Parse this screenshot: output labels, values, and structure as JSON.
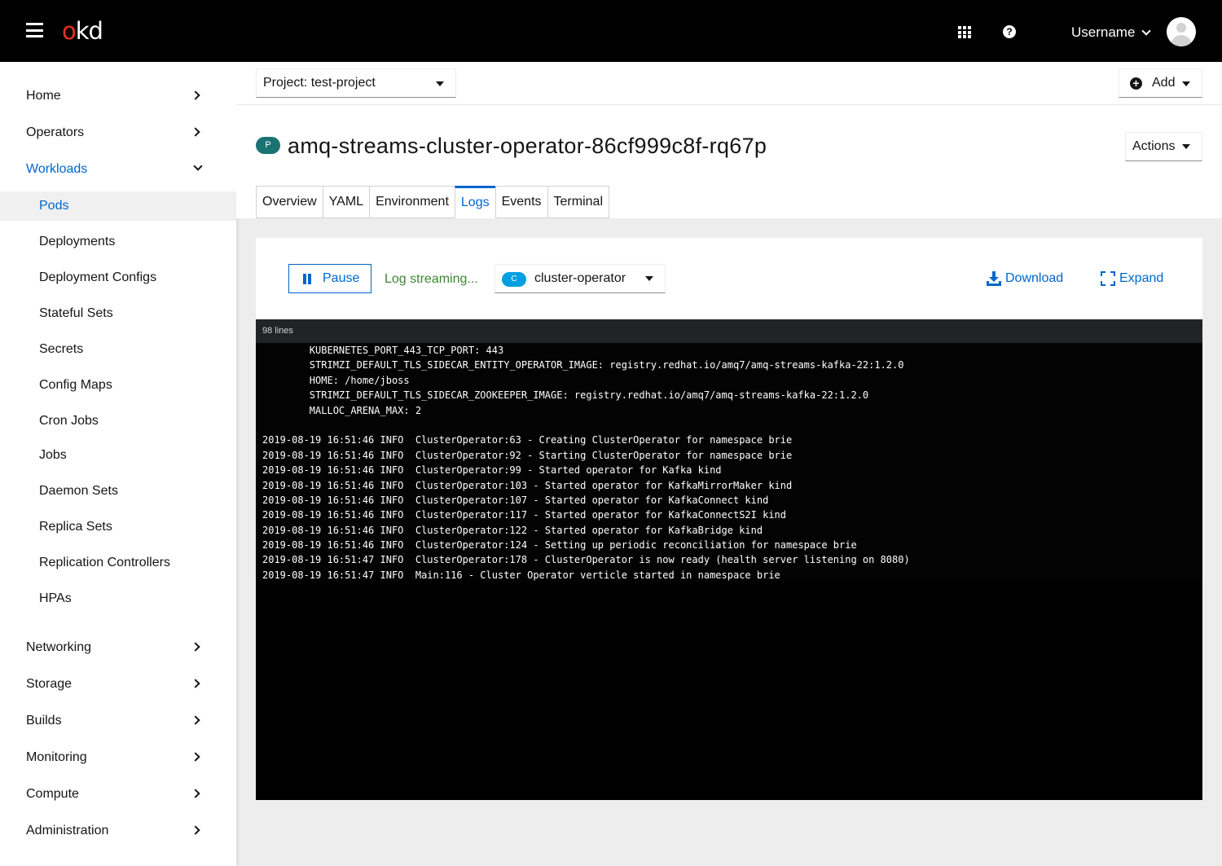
{
  "masthead": {
    "logo_o": "o",
    "logo_kd": "kd",
    "username": "Username"
  },
  "sidebar": {
    "sections_top": [
      {
        "label": "Home"
      },
      {
        "label": "Operators"
      }
    ],
    "workloads": {
      "label": "Workloads",
      "items": [
        {
          "label": "Pods",
          "active": true
        },
        {
          "label": "Deployments"
        },
        {
          "label": "Deployment Configs"
        },
        {
          "label": "Stateful Sets"
        },
        {
          "label": "Secrets"
        },
        {
          "label": "Config Maps"
        },
        {
          "label": "Cron Jobs"
        },
        {
          "label": "Jobs"
        },
        {
          "label": "Daemon Sets"
        },
        {
          "label": "Replica Sets"
        },
        {
          "label": "Replication Controllers"
        },
        {
          "label": "HPAs"
        }
      ]
    },
    "sections_bottom": [
      {
        "label": "Networking"
      },
      {
        "label": "Storage"
      },
      {
        "label": "Builds"
      },
      {
        "label": "Monitoring"
      },
      {
        "label": "Compute"
      },
      {
        "label": "Administration"
      }
    ]
  },
  "project": {
    "label": "Project: test-project"
  },
  "add_button": {
    "label": "Add"
  },
  "pod": {
    "badge": "P",
    "name": "amq-streams-cluster-operator-86cf999c8f-rq67p"
  },
  "actions_button": {
    "label": "Actions"
  },
  "tabs": [
    {
      "label": "Overview"
    },
    {
      "label": "YAML"
    },
    {
      "label": "Environment"
    },
    {
      "label": "Logs",
      "active": true
    },
    {
      "label": "Events"
    },
    {
      "label": "Terminal"
    }
  ],
  "logs": {
    "pause_label": "Pause",
    "status": "Log streaming...",
    "container_badge": "C",
    "container": "cluster-operator",
    "download_label": "Download",
    "expand_label": "Expand",
    "line_count": "98 lines",
    "lines": [
      "        KUBERNETES_PORT_443_TCP_PORT: 443",
      "        STRIMZI_DEFAULT_TLS_SIDECAR_ENTITY_OPERATOR_IMAGE: registry.redhat.io/amq7/amq-streams-kafka-22:1.2.0",
      "        HOME: /home/jboss",
      "        STRIMZI_DEFAULT_TLS_SIDECAR_ZOOKEEPER_IMAGE: registry.redhat.io/amq7/amq-streams-kafka-22:1.2.0",
      "        MALLOC_ARENA_MAX: 2",
      "",
      "2019-08-19 16:51:46 INFO  ClusterOperator:63 - Creating ClusterOperator for namespace brie",
      "2019-08-19 16:51:46 INFO  ClusterOperator:92 - Starting ClusterOperator for namespace brie",
      "2019-08-19 16:51:46 INFO  ClusterOperator:99 - Started operator for Kafka kind",
      "2019-08-19 16:51:46 INFO  ClusterOperator:103 - Started operator for KafkaMirrorMaker kind",
      "2019-08-19 16:51:46 INFO  ClusterOperator:107 - Started operator for KafkaConnect kind",
      "2019-08-19 16:51:46 INFO  ClusterOperator:117 - Started operator for KafkaConnectS2I kind",
      "2019-08-19 16:51:46 INFO  ClusterOperator:122 - Started operator for KafkaBridge kind",
      "2019-08-19 16:51:46 INFO  ClusterOperator:124 - Setting up periodic reconciliation for namespace brie",
      "2019-08-19 16:51:47 INFO  ClusterOperator:178 - ClusterOperator is now ready (health server listening on 8080)",
      "2019-08-19 16:51:47 INFO  Main:116 - Cluster Operator verticle started in namespace brie"
    ]
  },
  "colors": {
    "accent": "#0066cc",
    "logo_red": "#e8301e",
    "pod_badge": "#1a7272",
    "container_badge": "#009fe3",
    "streaming_green": "#3e8635",
    "masthead": "#000000"
  }
}
